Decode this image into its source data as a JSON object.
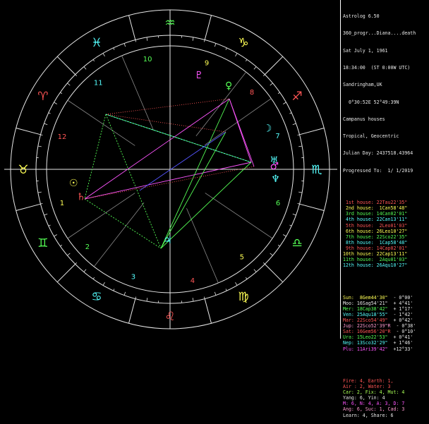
{
  "header": {
    "title": "Astrolog 6.50",
    "chart_name": "360_progr...Diana....death",
    "date": "Sat July 1, 1961",
    "time": "18:34:00  (ST 0:00W UTC)",
    "place": "Sandringham,UK",
    "coords": "  0°30:52E 52°49:39N",
    "houses": "Campanus houses",
    "zodiac": "Tropical, Geocentric",
    "julian": "Julian Day: 2437518.43964",
    "progressed": "Progressed To:  1/ 1/2019"
  },
  "house_cusps": [
    {
      "label": "1st house:",
      "value": "22Tau22'35\"",
      "color": "#ff5555"
    },
    {
      "label": "2nd house:",
      "value": " 1Can58'48\"",
      "color": "#ffff55"
    },
    {
      "label": "3rd house:",
      "value": "14Can02'01\"",
      "color": "#55ff55"
    },
    {
      "label": "4th house:",
      "value": "22Can13'11\"",
      "color": "#55ffff"
    },
    {
      "label": "5th house:",
      "value": " 2Leo01'03\"",
      "color": "#ff5555"
    },
    {
      "label": "6th house:",
      "value": "26Leo10'27\"",
      "color": "#ffff55"
    },
    {
      "label": "7th house:",
      "value": "22Sco22'35\"",
      "color": "#55ff55"
    },
    {
      "label": "8th house:",
      "value": " 1Cap58'48\"",
      "color": "#55ffff"
    },
    {
      "label": "9th house:",
      "value": "14Cap02'01\"",
      "color": "#ff5555"
    },
    {
      "label": "10th house:",
      "value": "22Cap13'11\"",
      "color": "#ffff55"
    },
    {
      "label": "11th house:",
      "value": " 2Aqu01'03\"",
      "color": "#55ff55"
    },
    {
      "label": "12th house:",
      "value": "26Aqu10'27\"",
      "color": "#55ffff"
    }
  ],
  "planets": [
    {
      "label": "Sun:",
      "value": " 8Gem44'30\"",
      "speed": " - 0°00'",
      "color": "#ffff55"
    },
    {
      "label": "Moo:",
      "value": "16Sag54'21\"",
      "speed": " + 4°41'",
      "color": "#e8e8e8"
    },
    {
      "label": "Mer:",
      "value": "18Cap38'42\"",
      "speed": " + 1°17'",
      "color": "#55ff55"
    },
    {
      "label": "Ven:",
      "value": "25Aqu18'55\"",
      "speed": " - 1°42'",
      "color": "#55ffff"
    },
    {
      "label": "Mar:",
      "value": "22Sco54'49\"",
      "speed": " + 0°42'",
      "color": "#ff5555"
    },
    {
      "label": "Jup:",
      "value": "22Sco52'39\"R",
      "speed": " - 0°38'",
      "color": "#ff9ad0"
    },
    {
      "label": "Sat:",
      "value": "16Gem56'20\"R",
      "speed": " - 0°10'",
      "color": "#ff5555"
    },
    {
      "label": "Ura:",
      "value": "15Leo22'53\"",
      "speed": " + 0°41'",
      "color": "#55ff55"
    },
    {
      "label": "Nep:",
      "value": "13Sco32'29\"",
      "speed": " + 1°46'",
      "color": "#55ffff"
    },
    {
      "label": "Plu:",
      "value": "11Ari39'42\"",
      "speed": " +12°33'",
      "color": "#ff55ff"
    }
  ],
  "elements": [
    {
      "text": "Fire: 4, Earth: 1,",
      "color": "#ff5555"
    },
    {
      "text": "Air : 2, Water: 3",
      "color": "#ff5555"
    },
    {
      "text": "Car: 2, Fix: 4, Mut: 4",
      "color": "#a8ff55"
    },
    {
      "text": "Yang: 6, Yin: 4",
      "color": "#e8e8e8"
    },
    {
      "text": "M: 6, N: 4, A: 3, D: 7",
      "color": "#ff55ff"
    },
    {
      "text": "Ang: 6, Suc: 1, Cad: 3",
      "color": "#ff9ad0"
    },
    {
      "text": "Learn: 4, Share: 6",
      "color": "#e8e8e8"
    }
  ],
  "wheel": {
    "sign_glyphs": [
      "♉",
      "♊",
      "♋",
      "♌",
      "♍",
      "♎",
      "♏",
      "♐",
      "♑",
      "♒",
      "♓",
      "♈"
    ],
    "house_numbers": [
      "1",
      "2",
      "3",
      "4",
      "5",
      "6",
      "7",
      "8",
      "9",
      "10",
      "11",
      "12"
    ],
    "planet_glyphs": [
      {
        "name": "sun",
        "glyph": "☉",
        "color": "#ffff55"
      },
      {
        "name": "saturn",
        "glyph": "♄",
        "color": "#ff5555"
      },
      {
        "name": "jupiter",
        "glyph": "♃",
        "color": "#55ffff"
      },
      {
        "name": "venus",
        "glyph": "♀",
        "color": "#55ff55"
      },
      {
        "name": "pluto",
        "glyph": "♇",
        "color": "#ff55ff"
      },
      {
        "name": "moon",
        "glyph": "☽",
        "color": "#55ffff"
      },
      {
        "name": "mars",
        "glyph": "♂",
        "color": "#ff55ff"
      },
      {
        "name": "neptune",
        "glyph": "♆",
        "color": "#55ffff"
      },
      {
        "name": "uranus",
        "glyph": "♅",
        "color": "#55ffff"
      }
    ],
    "colors": {
      "ring": "#e8e8e8",
      "grid": "#8a8a8a",
      "fire": "#ff5555",
      "earth": "#ffff55",
      "air": "#55ff55",
      "water": "#55ffff"
    }
  }
}
